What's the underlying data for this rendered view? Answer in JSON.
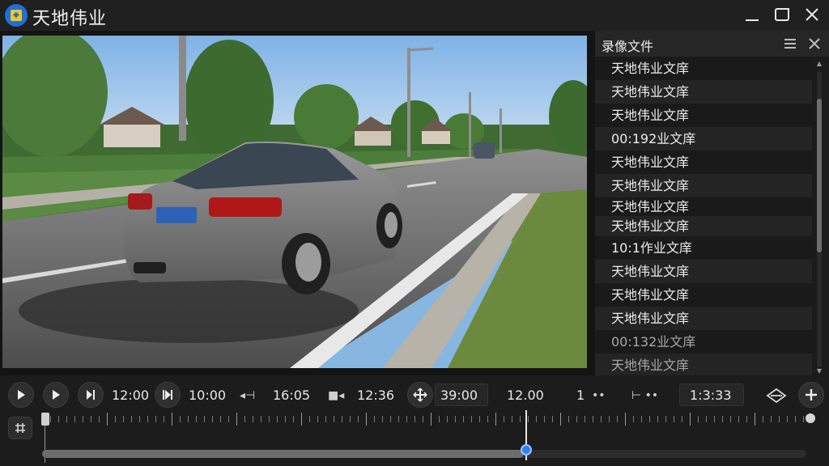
{
  "window": {
    "title": "天地伟业",
    "icon": "app-logo-icon"
  },
  "playlist": {
    "title": "录像文件",
    "items": [
      "天地伟业文庠",
      "天地伟业文庠",
      "天地伟业文庠",
      "00:192业文庠",
      "天地伟业文庠",
      "天地伟业文庠",
      "天地伟业文庠",
      "天地伟业文庠",
      "10:1作业文庠",
      "天地伟业文庠",
      "天地伟业文庠",
      "天地伟业文庠",
      "00:132业文庠",
      "天地伟业文庠"
    ]
  },
  "controls": {
    "time1": "12:00",
    "time2": "10:00",
    "time3": "16:05",
    "time4": "12:36",
    "time5": "39:00",
    "time6": "12.00",
    "count": "1",
    "time7": "1:3:33",
    "progress": 0.63
  },
  "colors": {
    "accent": "#2f7ff0",
    "background": "#141414",
    "panel": "#1c1c1c"
  }
}
